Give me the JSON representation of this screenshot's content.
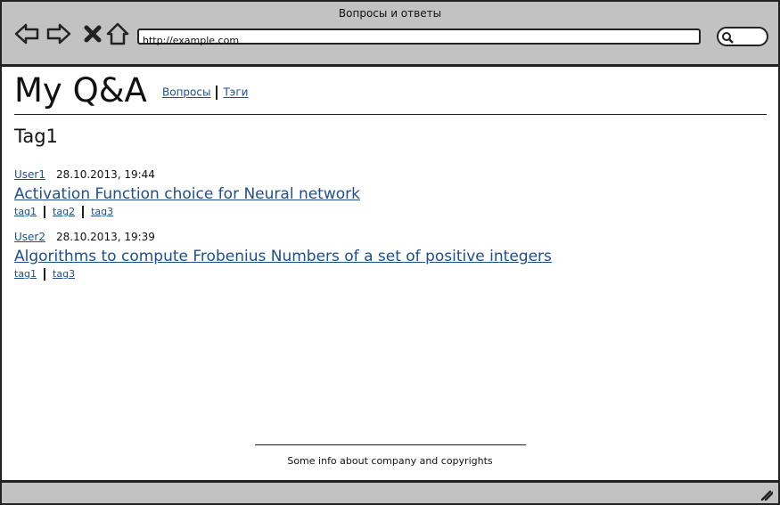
{
  "browser": {
    "title": "Вопросы и ответы",
    "url": "http://example.com"
  },
  "site": {
    "title": "My Q&A",
    "nav": [
      {
        "label": "Вопросы"
      },
      {
        "label": "Тэги"
      }
    ]
  },
  "page": {
    "tag_heading": "Tag1"
  },
  "questions": [
    {
      "user": "User1",
      "date": "28.10.2013, 19:44",
      "title": "Activation Function choice for Neural network",
      "tags": [
        "tag1",
        "tag2",
        "tag3"
      ]
    },
    {
      "user": "User2",
      "date": "28.10.2013, 19:39",
      "title": "Algorithms to compute Frobenius Numbers of a set of positive integers",
      "tags": [
        "tag1",
        "tag3"
      ]
    }
  ],
  "footer": {
    "text": "Some info about company and copyrights"
  },
  "colors": {
    "link": "#1f4e8c",
    "chrome": "#c2c2c2"
  }
}
